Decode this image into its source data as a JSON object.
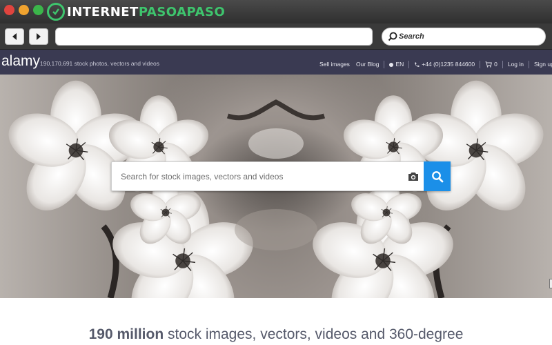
{
  "browser": {
    "brand_part1": "INTERNET",
    "brand_part2": "PASOAPASO",
    "url": "",
    "search_placeholder": "Search",
    "icons": [
      "back-arrow-icon",
      "forward-arrow-icon",
      "search-icon"
    ]
  },
  "site": {
    "logo": "alamy",
    "tagline": "190,170,691 stock photos, vectors and videos",
    "nav": {
      "sell_images": "Sell images",
      "our_blog": "Our Blog",
      "language": "EN",
      "phone": "+44 (0)1235 844600",
      "cart_count": "0",
      "log_in": "Log in",
      "sign_up": "Sign up"
    }
  },
  "hero": {
    "search_placeholder": "Search for stock images, vectors and videos",
    "search_value": ""
  },
  "headline": {
    "bold": "190 million",
    "rest": " stock images, vectors, videos and 360-degree"
  },
  "colors": {
    "brand_green": "#3ec46d",
    "site_nav_bg": "#3a3a52",
    "search_button": "#1b8fe8"
  }
}
